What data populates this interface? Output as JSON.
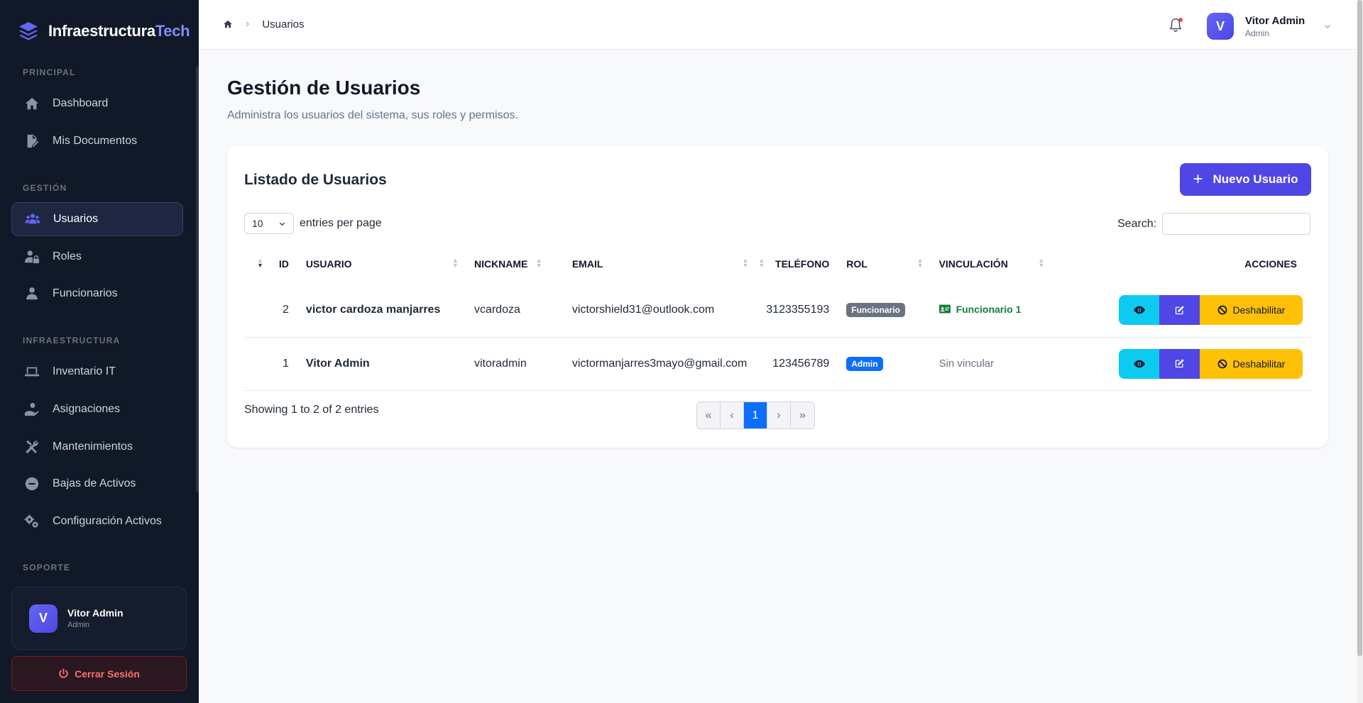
{
  "brand": {
    "name_main": "Infraestructura",
    "name_accent": "Tech"
  },
  "sidebar": {
    "sections": [
      {
        "title": "PRINCIPAL"
      },
      {
        "title": "GESTIÓN"
      },
      {
        "title": "INFRAESTRUCTURA"
      },
      {
        "title": "SOPORTE"
      }
    ],
    "items": [
      {
        "label": "Dashboard",
        "icon": "home-icon"
      },
      {
        "label": "Mis Documentos",
        "icon": "document-icon"
      },
      {
        "label": "Usuarios",
        "icon": "users-icon",
        "active": true
      },
      {
        "label": "Roles",
        "icon": "user-lock-icon"
      },
      {
        "label": "Funcionarios",
        "icon": "user-icon"
      },
      {
        "label": "Inventario IT",
        "icon": "laptop-icon"
      },
      {
        "label": "Asignaciones",
        "icon": "hand-user-icon"
      },
      {
        "label": "Mantenimientos",
        "icon": "tools-icon"
      },
      {
        "label": "Bajas de Activos",
        "icon": "minus-circle-icon"
      },
      {
        "label": "Configuración Activos",
        "icon": "gears-icon"
      }
    ],
    "user": {
      "initial": "V",
      "name": "Vitor Admin",
      "role": "Admin"
    },
    "logout_label": "Cerrar Sesión"
  },
  "topbar": {
    "breadcrumb_current": "Usuarios",
    "user": {
      "initial": "V",
      "name": "Vitor Admin",
      "role": "Admin"
    }
  },
  "main": {
    "title": "Gestión de Usuarios",
    "subtitle": "Administra los usuarios del sistema, sus roles y permisos.",
    "card_title": "Listado de Usuarios",
    "new_button": "Nuevo Usuario",
    "page_length": "10",
    "page_length_label": "entries per page",
    "search_label": "Search:",
    "search_value": "",
    "columns": [
      "ID",
      "USUARIO",
      "NICKNAME",
      "EMAIL",
      "TELÉFONO",
      "ROL",
      "VINCULACIÓN",
      "ACCIONES"
    ],
    "rows": [
      {
        "id": "2",
        "usuario": "victor cardoza manjarres",
        "nickname": "vcardoza",
        "email": "victorshield31@outlook.com",
        "telefono": "3123355193",
        "rol": "Funcionario",
        "vinculacion": "Funcionario 1",
        "disable_label": "Deshabilitar"
      },
      {
        "id": "1",
        "usuario": "Vitor Admin",
        "nickname": "vitoradmin",
        "email": "victormanjarres3mayo@gmail.com",
        "telefono": "123456789",
        "rol": "Admin",
        "vinculacion": "Sin vincular",
        "disable_label": "Deshabilitar"
      }
    ],
    "info": "Showing 1 to 2 of 2 entries",
    "pager": {
      "first": "«",
      "prev": "‹",
      "current": "1",
      "next": "›",
      "last": "»"
    }
  },
  "colors": {
    "accent": "#4f46e5",
    "sidebar_bg": "#111827",
    "info_btn": "#0dcaf0",
    "warning_btn": "#ffc107",
    "link_green": "#15803d"
  }
}
